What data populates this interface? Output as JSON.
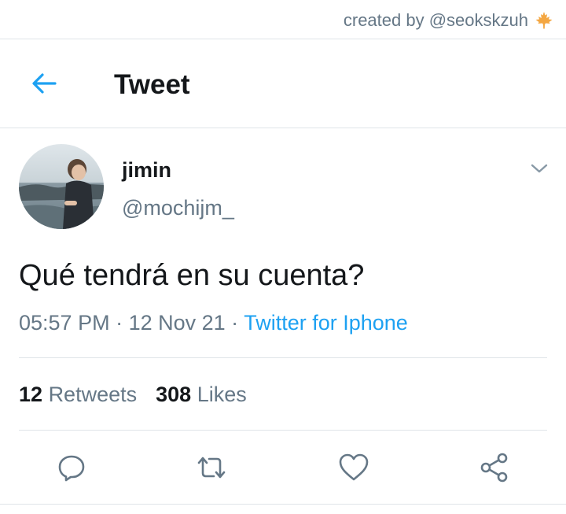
{
  "credit": {
    "text": "created by @seokskzuh",
    "icon": "maple-leaf-icon"
  },
  "header": {
    "title": "Tweet",
    "back_icon": "arrow-left-icon"
  },
  "tweet": {
    "author_name": "jimin",
    "author_handle": "@mochijm_",
    "text": "Qué tendrá en su cuenta?",
    "time": "05:57 PM",
    "separator": " · ",
    "date": "12 Nov 21",
    "source": "Twitter for Iphone",
    "retweets_count": "12",
    "retweets_label": "Retweets",
    "likes_count": "308",
    "likes_label": "Likes"
  },
  "actions": [
    "reply-icon",
    "retweet-icon",
    "like-icon",
    "share-icon"
  ],
  "colors": {
    "accent": "#1da1f2",
    "secondary_text": "#657786",
    "divider": "#dfe4e8",
    "leaf": "#f4a742"
  }
}
